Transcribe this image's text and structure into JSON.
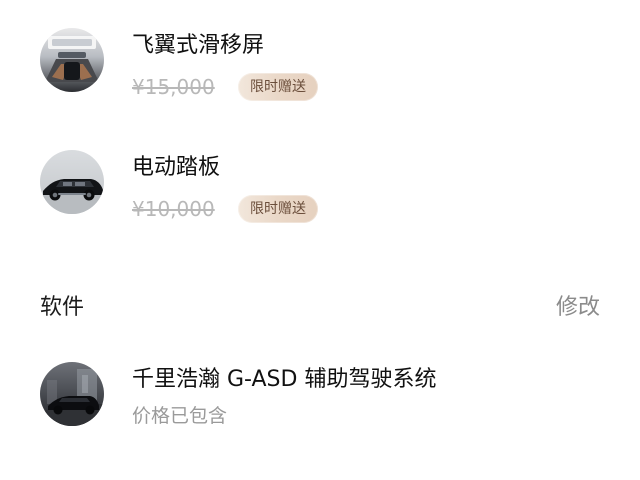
{
  "items": [
    {
      "title": "飞翼式滑移屏",
      "price": "¥15,000",
      "badge": "限时赠送"
    },
    {
      "title": "电动踏板",
      "price": "¥10,000",
      "badge": "限时赠送"
    }
  ],
  "software": {
    "section_title": "软件",
    "action_label": "修改",
    "items": [
      {
        "title": "千里浩瀚 G-ASD 辅助驾驶系统",
        "subtitle": "价格已包含"
      }
    ]
  },
  "colors": {
    "title": "#111111",
    "muted": "#9a9a9a",
    "price_strike": "#b8b8b8",
    "badge_bg": "#eadbcf",
    "badge_text": "#6b4e3b"
  },
  "icons": {
    "item_0": "car-interior-screen-icon",
    "item_1": "electric-step-car-icon",
    "software_0": "car-driving-system-icon"
  }
}
